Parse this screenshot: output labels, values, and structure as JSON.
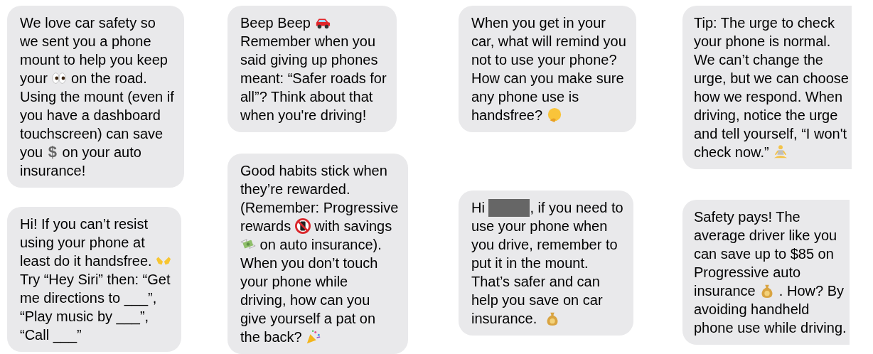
{
  "columns": [
    {
      "messages": [
        {
          "lines": [
            [
              {
                "text": "We love car safety so"
              }
            ],
            [
              {
                "text": "we sent you a phone"
              }
            ],
            [
              {
                "text": "mount to help you keep"
              }
            ],
            [
              {
                "text": "your "
              },
              {
                "kind": "eyes"
              },
              {
                "text": " on the road."
              }
            ],
            [
              {
                "text": "Using the mount (even if"
              }
            ],
            [
              {
                "text": "you have a dashboard"
              }
            ],
            [
              {
                "text": "touchscreen) can save"
              }
            ],
            [
              {
                "text": "you "
              },
              {
                "kind": "symbol",
                "text": "$"
              },
              {
                "text": " on your auto"
              }
            ],
            [
              {
                "text": "insurance!"
              }
            ]
          ]
        },
        {
          "lines": [
            [
              {
                "text": "Hi! If you can’t resist"
              }
            ],
            [
              {
                "text": "using your phone at"
              }
            ],
            [
              {
                "text": "least do it handsfree. "
              },
              {
                "kind": "hands"
              }
            ],
            [
              {
                "text": "Try “Hey Siri” then: “Get"
              }
            ],
            [
              {
                "text": "me directions to ___”,"
              }
            ],
            [
              {
                "text": "“Play music by ___”,"
              }
            ],
            [
              {
                "text": "“Call ___”"
              }
            ]
          ]
        }
      ]
    },
    {
      "messages": [
        {
          "lines": [
            [
              {
                "text": "Beep Beep "
              },
              {
                "kind": "car"
              }
            ],
            [
              {
                "text": "Remember when you"
              }
            ],
            [
              {
                "text": "said giving up phones"
              }
            ],
            [
              {
                "text": "meant: “Safer roads for"
              }
            ],
            [
              {
                "text": "all”? Think about that"
              }
            ],
            [
              {
                "text": "when you're driving!"
              }
            ]
          ]
        },
        {
          "lines": [
            [
              {
                "text": "Good habits stick when"
              }
            ],
            [
              {
                "text": "they’re rewarded."
              }
            ],
            [
              {
                "text": "(Remember: Progressive"
              }
            ],
            [
              {
                "text": "rewards "
              },
              {
                "kind": "nophone"
              },
              {
                "text": " with savings"
              }
            ],
            [
              {
                "kind": "moneywings"
              },
              {
                "text": " on auto insurance)."
              }
            ],
            [
              {
                "text": "When you don’t touch"
              }
            ],
            [
              {
                "text": "your phone while"
              }
            ],
            [
              {
                "text": "driving, how can you"
              }
            ],
            [
              {
                "text": "give yourself a pat on"
              }
            ],
            [
              {
                "text": "the back? "
              },
              {
                "kind": "party"
              }
            ]
          ]
        }
      ]
    },
    {
      "messages": [
        {
          "lines": [
            [
              {
                "text": "When you get in your"
              }
            ],
            [
              {
                "text": "car, what will remind you"
              }
            ],
            [
              {
                "text": "not to use your phone?"
              }
            ],
            [
              {
                "text": "How can you make sure"
              }
            ],
            [
              {
                "text": "any phone use is"
              }
            ],
            [
              {
                "text": "handsfree? "
              },
              {
                "kind": "thinking"
              }
            ]
          ]
        },
        {
          "lines": [
            [
              {
                "text": "Hi "
              },
              {
                "kind": "redacted"
              },
              {
                "text": ", if you need to"
              }
            ],
            [
              {
                "text": "use your phone when"
              }
            ],
            [
              {
                "text": "you drive, remember to"
              }
            ],
            [
              {
                "text": "put it in the mount."
              }
            ],
            [
              {
                "text": "That’s safer and can"
              }
            ],
            [
              {
                "text": "help you save on car"
              }
            ],
            [
              {
                "text": "insurance.  "
              },
              {
                "kind": "moneybag"
              }
            ]
          ]
        }
      ]
    },
    {
      "messages": [
        {
          "lines": [
            [
              {
                "text": "Tip: The urge to check"
              }
            ],
            [
              {
                "text": "your phone is normal."
              }
            ],
            [
              {
                "text": "We can’t change the"
              }
            ],
            [
              {
                "text": "urge, but we can choose"
              }
            ],
            [
              {
                "text": "how we respond. When"
              }
            ],
            [
              {
                "text": "driving, notice the urge"
              }
            ],
            [
              {
                "text": "and tell yourself, “I won't"
              }
            ],
            [
              {
                "text": "check now.” "
              },
              {
                "kind": "meditate"
              }
            ]
          ]
        },
        {
          "lines": [
            [
              {
                "text": "Safety pays! The"
              }
            ],
            [
              {
                "text": "average driver like you"
              }
            ],
            [
              {
                "text": "can save up to $85 on"
              }
            ],
            [
              {
                "text": "Progressive auto"
              }
            ],
            [
              {
                "text": "insurance "
              },
              {
                "kind": "moneybag"
              },
              {
                "text": " . How? By"
              }
            ],
            [
              {
                "text": "avoiding handheld"
              }
            ],
            [
              {
                "text": "phone use while driving."
              }
            ]
          ]
        }
      ]
    }
  ]
}
